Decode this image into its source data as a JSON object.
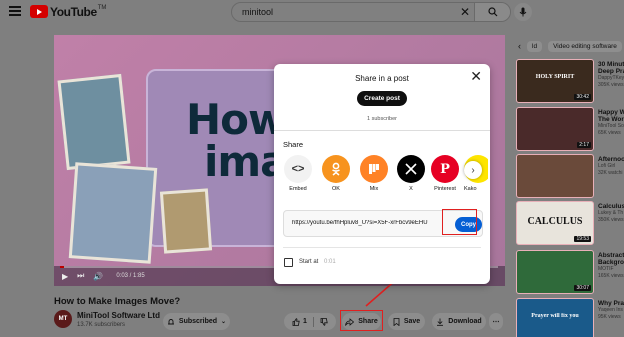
{
  "header": {
    "logo_text": "YouTube",
    "logo_sup": "TM",
    "search_value": "minitool"
  },
  "player": {
    "title_line1": "How t",
    "title_line2": "imag",
    "progress": 0.01,
    "current_time": "0:03",
    "duration": "1:85"
  },
  "video": {
    "title": "How to Make Images Move?",
    "avatar_text": "MT",
    "channel": "MiniTool Software Ltd",
    "subscribers": "13.7K subscribers",
    "subscribed_label": "Subscribed",
    "like_count": "1",
    "share_label": "Share",
    "save_label": "Save",
    "download_label": "Download"
  },
  "sidebar": {
    "chips": [
      "ld",
      "Video editing software"
    ],
    "recommendations": [
      {
        "title": "30 Minut",
        "title2": "Deep Pra",
        "channel": "DappyTKey",
        "meta": "305K views",
        "duration": "30:42",
        "thumb_text": "HOLY SPIRIT",
        "color": "#3a2a1e"
      },
      {
        "title": "Happy W",
        "title2": "The Worl",
        "channel": "MiniTool So",
        "meta": "65K views",
        "duration": "2:17",
        "thumb_text": "",
        "color": "#4a2a2a"
      },
      {
        "title": "Afternoo",
        "title2": "",
        "channel": "Lofi Girl",
        "meta": "32K watchi",
        "duration": "",
        "thumb_text": "",
        "color": "#6a4a3a"
      },
      {
        "title": "Calculus",
        "title2": "",
        "channel": "Lukey & Th",
        "meta": "350K views",
        "duration": "19:53",
        "thumb_text": "CALCULUS",
        "color": "#e8e4dc"
      },
      {
        "title": "Abstract",
        "title2": "Backgrou",
        "channel": "MOTIF",
        "meta": "165K views",
        "duration": "30:07",
        "thumb_text": "",
        "color": "#2f6a3a"
      },
      {
        "title": "Why Pra",
        "title2": "",
        "channel": "Yaqeen Ins",
        "meta": "95K views",
        "duration": "",
        "thumb_text": "Prayer will fix you",
        "color": "#1a5a8a"
      }
    ]
  },
  "modal": {
    "heading": "Share in a post",
    "create_post": "Create post",
    "subscriber_count": "1 subscriber",
    "share_heading": "Share",
    "targets": [
      {
        "label": "Embed",
        "icon": "embed-icon",
        "color": "#f2f2f2"
      },
      {
        "label": "OK",
        "icon": "ok-icon",
        "color": "#f7931e"
      },
      {
        "label": "Mix",
        "icon": "mix-icon",
        "color": "#ff8226"
      },
      {
        "label": "X",
        "icon": "x-icon",
        "color": "#000000"
      },
      {
        "label": "Pinterest",
        "icon": "pinterest-icon",
        "color": "#e60023"
      },
      {
        "label": "Kako",
        "icon": "kakao-icon",
        "color": "#fee500"
      }
    ],
    "url": "https://youtu.be/fhHpluv8_U?si=X5F-xrFbcv9eEHU",
    "copy_label": "Copy",
    "start_label": "Start at",
    "start_time": "0:01"
  },
  "colors": {
    "accent_blue": "#065fd4",
    "highlight_red": "#e02020",
    "brand_red": "#ff0000"
  }
}
